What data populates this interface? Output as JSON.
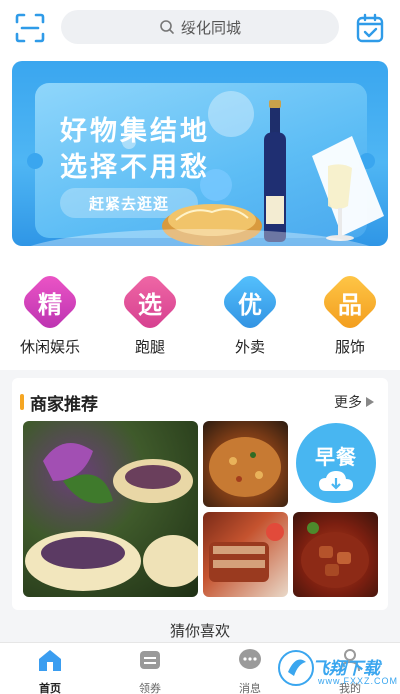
{
  "header": {
    "scan_icon": "scan-icon",
    "search_placeholder": "绥化同城",
    "calendar_icon": "calendar-check-icon"
  },
  "banner": {
    "line1": "好物集结地",
    "line2": "选择不用愁",
    "cta": "赶紧去逛逛"
  },
  "categories": [
    {
      "glyph": "精",
      "label": "休闲娱乐",
      "color": "#d83fb7"
    },
    {
      "glyph": "选",
      "label": "跑腿",
      "color": "#e04a9c"
    },
    {
      "glyph": "优",
      "label": "外卖",
      "color": "#39a7f0"
    },
    {
      "glyph": "品",
      "label": "服饰",
      "color": "#f5a524"
    }
  ],
  "merchants": {
    "title": "商家推荐",
    "more": "更多",
    "breakfast": "早餐"
  },
  "guess": "猜你喜欢",
  "tabs": [
    {
      "label": "首页",
      "icon": "home-icon",
      "active": true
    },
    {
      "label": "领券",
      "icon": "coupon-icon",
      "active": false
    },
    {
      "label": "消息",
      "icon": "message-icon",
      "active": false
    },
    {
      "label": "我的",
      "icon": "user-icon",
      "active": false
    }
  ],
  "watermark": {
    "text": "飞翔下载",
    "url": "www.FXXZ.COM"
  }
}
